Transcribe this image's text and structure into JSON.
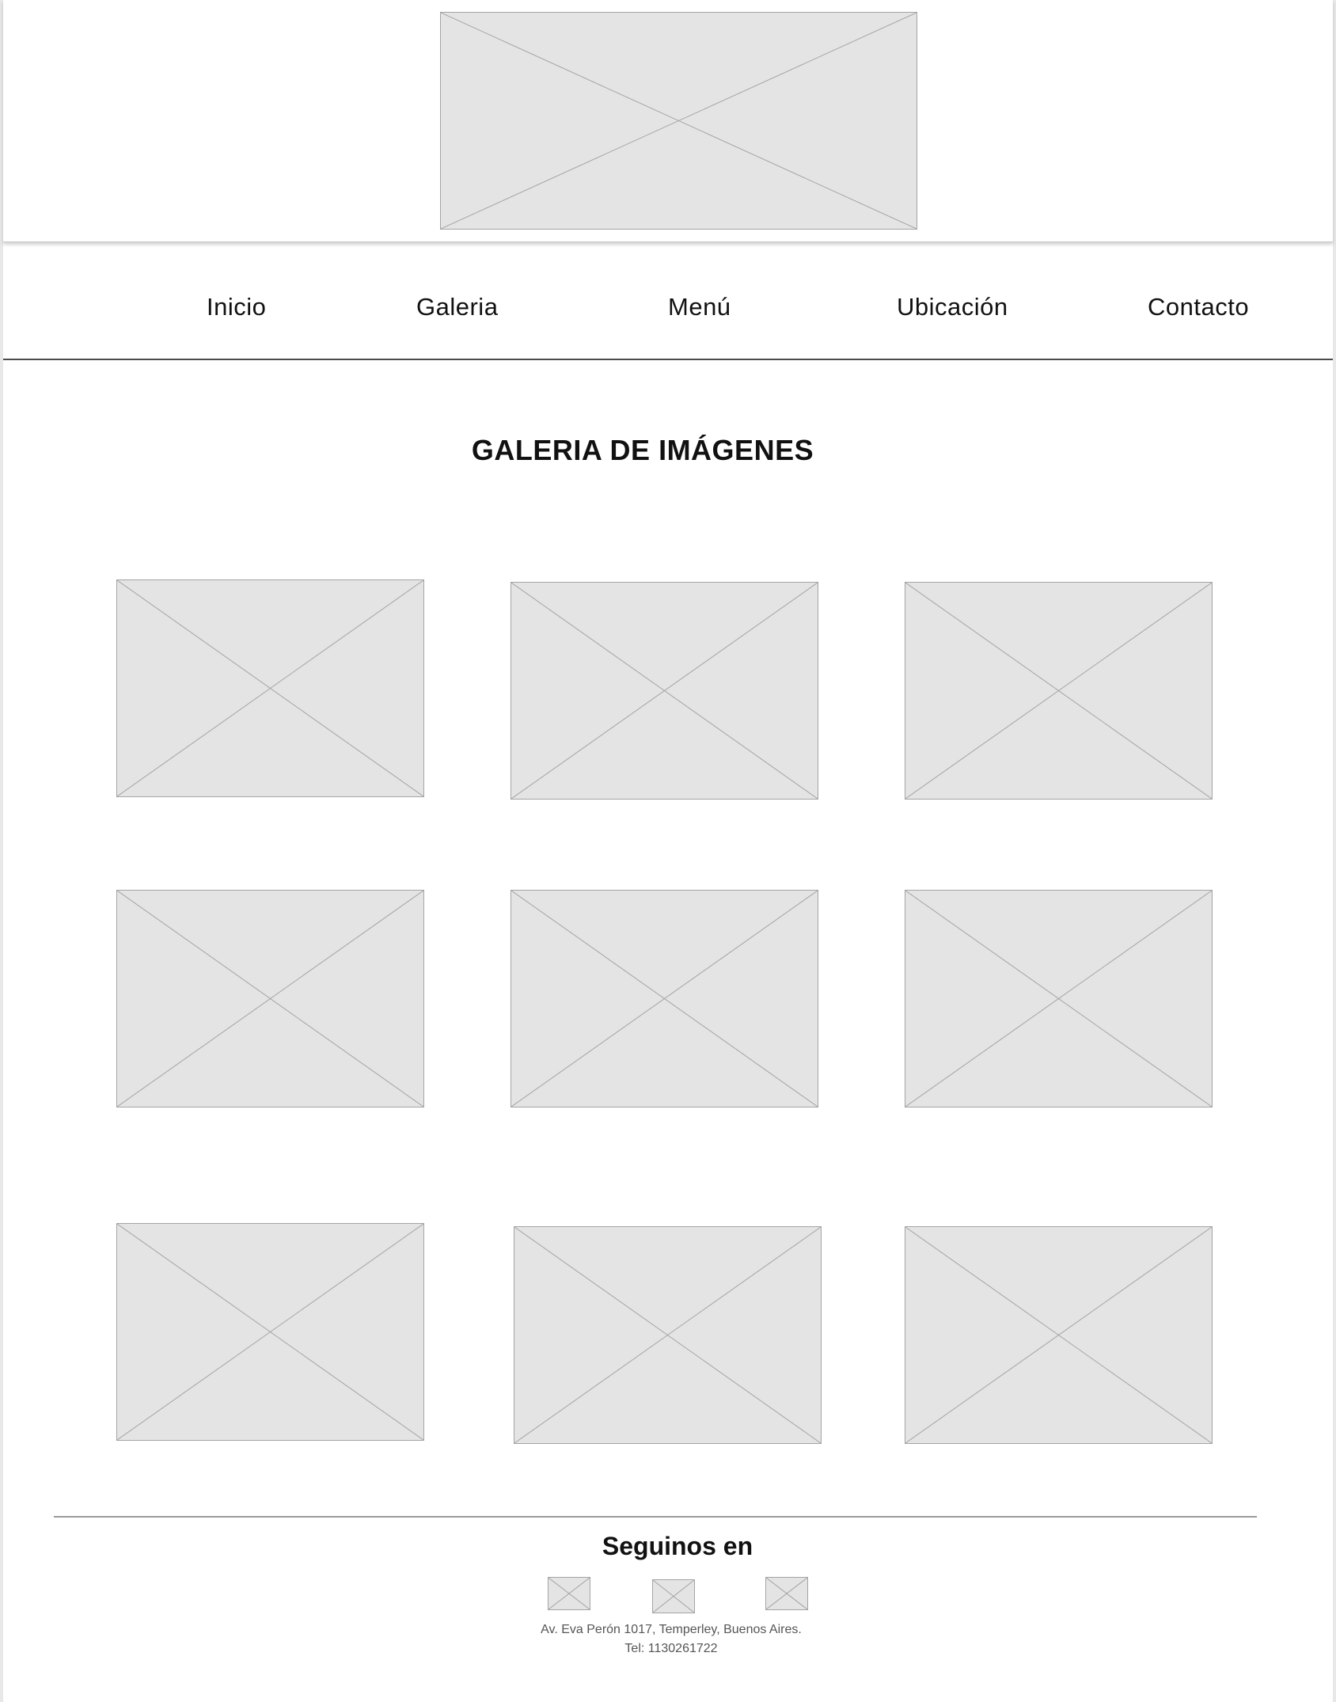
{
  "nav": {
    "items": [
      {
        "label": "Inicio"
      },
      {
        "label": "Galeria"
      },
      {
        "label": "Menú"
      },
      {
        "label": "Ubicación"
      },
      {
        "label": "Contacto"
      }
    ]
  },
  "main": {
    "title": "GALERIA DE IMÁGENES",
    "gallery_count": 9
  },
  "footer": {
    "follow_label": "Seguinos en",
    "social_icons": [
      "social-icon-placeholder",
      "social-icon-placeholder",
      "social-icon-placeholder"
    ],
    "address": "Av. Eva Perón 1017, Temperley, Buenos Aires.",
    "phone": "Tel: 1130261722"
  },
  "colors": {
    "placeholder_fill": "#e4e4e4",
    "placeholder_stroke": "#a4a4a4",
    "text": "#111111"
  }
}
